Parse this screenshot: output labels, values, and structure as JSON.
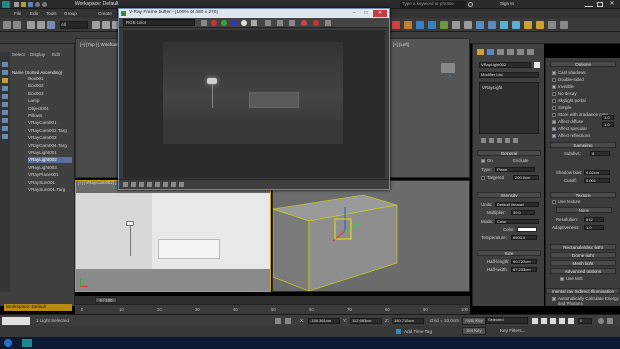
{
  "app": {
    "workspace": "Workspace: Default",
    "search_placeholder": "Type a keyword or phrase",
    "user": "Sign In"
  },
  "menu": [
    "File",
    "Edit",
    "Tools",
    "Group",
    "Create"
  ],
  "explorer": {
    "tabs": [
      "Select",
      "Display",
      "Edit"
    ],
    "header": "Name (Sorted Ascending)",
    "items": [
      {
        "name": "Box001",
        "selected": false
      },
      {
        "name": "Box002",
        "selected": false
      },
      {
        "name": "Box003",
        "selected": false
      },
      {
        "name": "Lamp",
        "selected": false
      },
      {
        "name": "Object001",
        "selected": false
      },
      {
        "name": "Pillows",
        "selected": false
      },
      {
        "name": "VRayCam001",
        "selected": false
      },
      {
        "name": "VRayCam002.Targ",
        "selected": false
      },
      {
        "name": "VRayCam003",
        "selected": false
      },
      {
        "name": "VRayCam004.Targ",
        "selected": false
      },
      {
        "name": "VRayLight001",
        "selected": false
      },
      {
        "name": "VRayLight002",
        "selected": true
      },
      {
        "name": "VRayLight003",
        "selected": false
      },
      {
        "name": "VRayPlane001",
        "selected": false
      },
      {
        "name": "VRaySun001",
        "selected": false
      },
      {
        "name": "VRaySun001.Targ",
        "selected": false
      }
    ],
    "workspace_label": "Workspace: Default"
  },
  "viewports": {
    "top_left_label": "[+] [Top ] [ Wireframe ]",
    "bottom_left_label": "[+] [VRayCam002] [ Standard ]",
    "bottom_right_label": "[+] [Perspective]",
    "top_right_label": "[+] [Left]"
  },
  "vfb": {
    "title": "V-Ray Frame buffer - [100% of 480 x 270]",
    "channel": "RGB color"
  },
  "command_panel": {
    "object_name": "VRayLight002",
    "modifier_list": "Modifier List",
    "stack_item": "VRayLight",
    "general": {
      "title": "General",
      "on": "On",
      "exclude": "Exclude",
      "type_label": "Type:",
      "type_value": "Plane",
      "targeted": "Targeted",
      "targeted_value": "200.0cm"
    },
    "intensity": {
      "title": "Intensity",
      "units_label": "Units:",
      "units_value": "Default (image)",
      "multiplier_label": "Multiplier:",
      "multiplier_value": "30.0",
      "mode_label": "Mode:",
      "mode_value": "Color",
      "color_label": "Color:",
      "temperature_label": "Temperature:",
      "temperature_value": "6500.0"
    },
    "size": {
      "title": "Size",
      "half_length_label": "Half-length:",
      "half_length_value": "90.722cm",
      "half_width_label": "Half-width:",
      "half_width_value": "67.233cm"
    }
  },
  "vray_panel": {
    "options_title": "Options",
    "options": [
      {
        "label": "Cast shadows",
        "checked": true
      },
      {
        "label": "Double-sided",
        "checked": false
      },
      {
        "label": "Invisible",
        "checked": true
      },
      {
        "label": "No decay",
        "checked": false
      },
      {
        "label": "Skylight portal",
        "checked": false
      },
      {
        "label": "Simple",
        "checked": false
      },
      {
        "label": "Store with irradiance map",
        "checked": false
      },
      {
        "label": "Affect diffuse",
        "checked": true
      },
      {
        "label": "Affect specular",
        "checked": true
      },
      {
        "label": "Affect reflections",
        "checked": true
      }
    ],
    "affect_diffuse_value": "1.0",
    "affect_specular_value": "1.0",
    "sampling_title": "Sampling",
    "subdivs_label": "Subdivs:",
    "subdivs_value": "8",
    "shadow_bias_label": "Shadow bias:",
    "shadow_bias_value": "0.02cm",
    "cutoff_label": "Cutoff:",
    "cutoff_value": "0.001",
    "texture_title": "Texture",
    "use_texture": "Use texture",
    "none": "None",
    "resolution_label": "Resolution:",
    "resolution_value": "512",
    "adaptiveness_label": "Adaptiveness:",
    "adaptiveness_value": "1.0",
    "rect_title": "Rectangle/disc light",
    "dome_title": "Dome light",
    "mesh_title": "Mesh light",
    "advanced_title": "Advanced options",
    "use_mis": "Use MIS",
    "mr_title": "mental ray Indirect Illumination",
    "auto_calc": "Automatically Calculate Energy and Photons"
  },
  "timeline": {
    "frame": "0 / 100",
    "ticks": [
      "0",
      "10",
      "20",
      "30",
      "40",
      "50",
      "60",
      "70",
      "80",
      "90",
      "100"
    ]
  },
  "status": {
    "selection": "1 Light Selected",
    "x_label": "X:",
    "x_value": "-158.361cm",
    "y_label": "Y:",
    "y_value": "112.683cm",
    "z_label": "Z:",
    "z_value": "180.715cm",
    "grid": "Grid = 10.0cm",
    "auto_key": "Auto Key",
    "selected": "Selected",
    "set_key": "Set Key",
    "key_filters": "Key Filters...",
    "add_time_tag": "Add Time Tag",
    "frame_value": "0"
  },
  "colors": {
    "accent": "#cfa600",
    "selection": "#5a6f9a",
    "gizmo_yellow": "#e6e600",
    "gizmo_green": "#3ad13a",
    "gizmo_red": "#e03030",
    "gizmo_blue": "#3050e0"
  }
}
